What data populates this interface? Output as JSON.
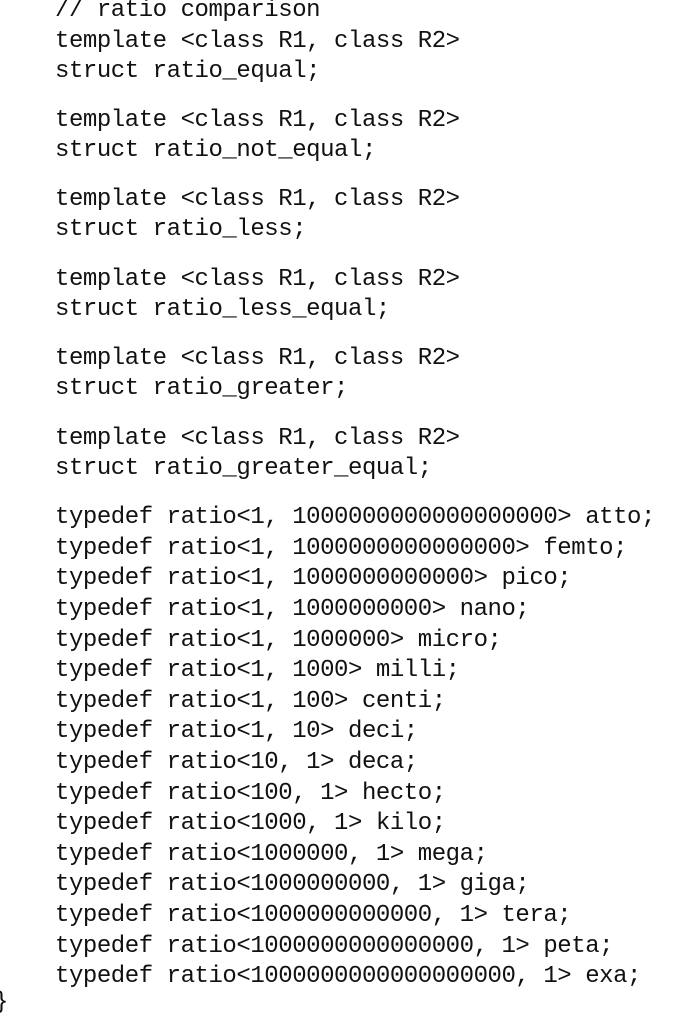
{
  "comment": "// ratio comparison",
  "comparisons": [
    {
      "template": "template <class R1, class R2>",
      "decl": "struct ratio_equal;"
    },
    {
      "template": "template <class R1, class R2>",
      "decl": "struct ratio_not_equal;"
    },
    {
      "template": "template <class R1, class R2>",
      "decl": "struct ratio_less;"
    },
    {
      "template": "template <class R1, class R2>",
      "decl": "struct ratio_less_equal;"
    },
    {
      "template": "template <class R1, class R2>",
      "decl": "struct ratio_greater;"
    },
    {
      "template": "template <class R1, class R2>",
      "decl": "struct ratio_greater_equal;"
    }
  ],
  "typedefs": [
    "typedef ratio<1, 1000000000000000000> atto;",
    "typedef ratio<1, 1000000000000000> femto;",
    "typedef ratio<1, 1000000000000> pico;",
    "typedef ratio<1, 1000000000> nano;",
    "typedef ratio<1, 1000000> micro;",
    "typedef ratio<1, 1000> milli;",
    "typedef ratio<1, 100> centi;",
    "typedef ratio<1, 10> deci;",
    "typedef ratio<10, 1> deca;",
    "typedef ratio<100, 1> hecto;",
    "typedef ratio<1000, 1> kilo;",
    "typedef ratio<1000000, 1> mega;",
    "typedef ratio<1000000000, 1> giga;",
    "typedef ratio<1000000000000, 1> tera;",
    "typedef ratio<1000000000000000, 1> peta;",
    "typedef ratio<1000000000000000000, 1> exa;"
  ],
  "closing_brace": "}"
}
